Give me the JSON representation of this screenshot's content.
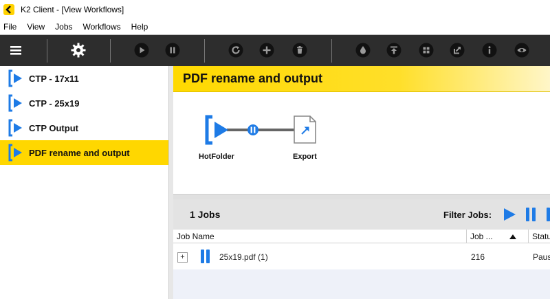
{
  "window": {
    "title": "K2 Client - [View Workflows]"
  },
  "menu": [
    "File",
    "View",
    "Jobs",
    "Workflows",
    "Help"
  ],
  "toolbar": {
    "groups": [
      [
        "hamburger-icon"
      ],
      [
        "settings-gear-icon"
      ],
      [
        "play-icon",
        "pause-icon"
      ],
      [
        "refresh-icon",
        "add-icon",
        "delete-icon"
      ],
      [
        "drop-icon",
        "upload-icon",
        "grid-icon",
        "share-icon",
        "info-icon",
        "view-icon"
      ]
    ]
  },
  "sidebar": {
    "items": [
      {
        "label": "CTP - 17x11",
        "selected": false
      },
      {
        "label": "CTP - 25x19",
        "selected": false
      },
      {
        "label": "CTP Output",
        "selected": false
      },
      {
        "label": "PDF rename and output",
        "selected": true
      }
    ]
  },
  "workflow": {
    "title": "PDF rename and output",
    "nodes": [
      {
        "label": "HotFolder",
        "icon": "hotfolder-icon"
      },
      {
        "label": "Export",
        "icon": "export-icon"
      }
    ]
  },
  "jobs": {
    "count_label": "1 Jobs",
    "filter_label": "Filter Jobs:",
    "columns": [
      "Job Name",
      "Job ...",
      "Statu"
    ],
    "rows": [
      {
        "expander": "+",
        "name": "25x19.pdf (1)",
        "job": "216",
        "status": "Paus"
      }
    ]
  },
  "colors": {
    "accent": "#ffd700",
    "blue": "#1e7be6",
    "toolbar": "#2d2d2d"
  }
}
